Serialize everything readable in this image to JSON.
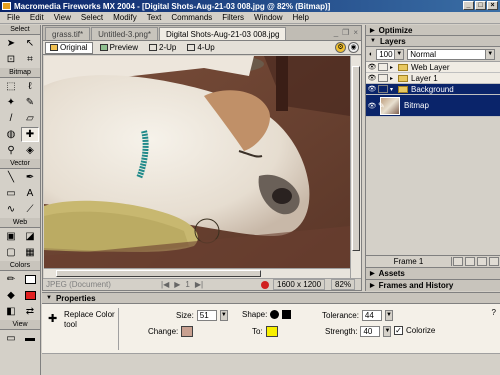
{
  "window": {
    "title": "Macromedia Fireworks MX 2004 - [Digital Shots-Aug-21-03 008.jpg @ 82% (Bitmap)]"
  },
  "menu": [
    "File",
    "Edit",
    "View",
    "Select",
    "Modify",
    "Text",
    "Commands",
    "Filters",
    "Window",
    "Help"
  ],
  "tools": {
    "sections": [
      "Select",
      "Bitmap",
      "Vector",
      "Web",
      "Colors",
      "View"
    ]
  },
  "document": {
    "tabs": [
      "grass.tif*",
      "Untitled-3.png*",
      "Digital Shots-Aug-21-03 008.jpg"
    ],
    "view_tabs": [
      "Original",
      "Preview",
      "2-Up",
      "4-Up"
    ],
    "status": {
      "format": "JPEG (Document)",
      "frame": "1",
      "dimensions": "1600 x 1200",
      "zoom": "82%"
    }
  },
  "panels": {
    "optimize": "Optimize",
    "layers": {
      "title": "Layers",
      "opacity": "100",
      "blend_mode": "Normal",
      "items": [
        {
          "name": "Web Layer"
        },
        {
          "name": "Layer 1"
        },
        {
          "name": "Background"
        },
        {
          "name": "Bitmap"
        }
      ],
      "frame_label": "Frame 1"
    },
    "assets": "Assets",
    "frames": "Frames and History"
  },
  "properties": {
    "title": "Properties",
    "tool_name": "Replace Color tool",
    "size_label": "Size:",
    "size_value": "51",
    "change_label": "Change:",
    "shape_label": "Shape:",
    "to_label": "To:",
    "tolerance_label": "Tolerance:",
    "tolerance_value": "44",
    "strength_label": "Strength:",
    "strength_value": "40",
    "colorize_label": "Colorize"
  },
  "colors": {
    "change": "#c8a090",
    "to": "#f8f000",
    "accent": "#0a246a"
  }
}
